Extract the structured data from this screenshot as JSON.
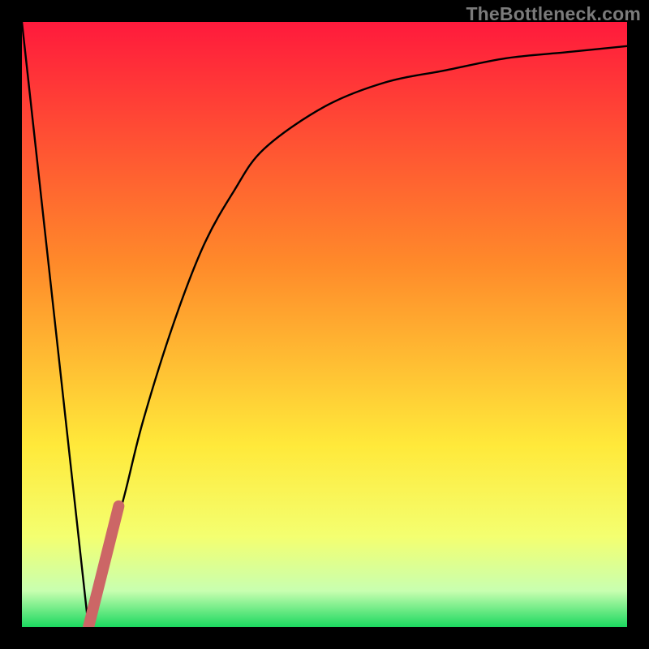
{
  "watermark": "TheBottleneck.com",
  "colors": {
    "page_bg": "#000000",
    "gradient_top": "#ff1a3c",
    "gradient_mid1": "#ff8a2a",
    "gradient_mid2": "#ffe93a",
    "gradient_lemon": "#f4ff70",
    "gradient_pale": "#c8ffb0",
    "gradient_green": "#1bd85f",
    "curve_stroke": "#000000",
    "highlight_stroke": "#cc6666"
  },
  "chart_data": {
    "type": "line",
    "title": "",
    "xlabel": "",
    "ylabel": "",
    "xlim": [
      0,
      1
    ],
    "ylim": [
      0,
      1
    ],
    "series": [
      {
        "name": "bottleneck-curve",
        "x": [
          0.0,
          0.11,
          0.14,
          0.17,
          0.2,
          0.25,
          0.3,
          0.35,
          0.4,
          0.5,
          0.6,
          0.7,
          0.8,
          0.9,
          1.0
        ],
        "values": [
          1.0,
          0.0,
          0.11,
          0.22,
          0.34,
          0.5,
          0.63,
          0.72,
          0.79,
          0.86,
          0.9,
          0.92,
          0.94,
          0.95,
          0.96
        ]
      },
      {
        "name": "highlight-segment",
        "x": [
          0.11,
          0.16
        ],
        "values": [
          0.0,
          0.2
        ]
      }
    ],
    "background_gradient_stops": [
      {
        "offset": 0.0,
        "color": "#ff1a3c"
      },
      {
        "offset": 0.4,
        "color": "#ff8a2a"
      },
      {
        "offset": 0.7,
        "color": "#ffe93a"
      },
      {
        "offset": 0.85,
        "color": "#f4ff70"
      },
      {
        "offset": 0.94,
        "color": "#c8ffb0"
      },
      {
        "offset": 1.0,
        "color": "#1bd85f"
      }
    ]
  }
}
